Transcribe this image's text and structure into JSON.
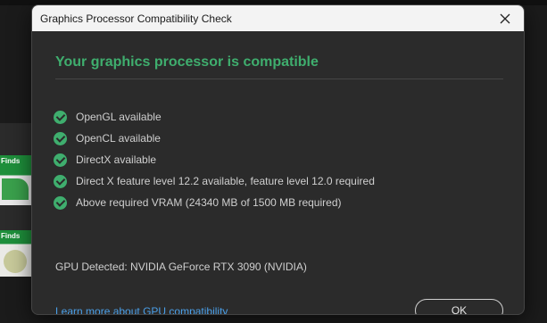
{
  "background": {
    "thumbnails": [
      {
        "label": "Finds"
      },
      {
        "label": "Finds"
      }
    ]
  },
  "dialog": {
    "title": "Graphics Processor Compatibility Check",
    "close_icon": "close-icon",
    "heading": "Your graphics processor is compatible",
    "checks": [
      {
        "icon": "check-circle-icon",
        "text": "OpenGL available"
      },
      {
        "icon": "check-circle-icon",
        "text": "OpenCL available"
      },
      {
        "icon": "check-circle-icon",
        "text": "DirectX available"
      },
      {
        "icon": "check-circle-icon",
        "text": "Direct X feature level 12.2 available, feature level 12.0 required"
      },
      {
        "icon": "check-circle-icon",
        "text": "Above required VRAM (24340 MB of 1500 MB required)"
      }
    ],
    "gpu_detected": "GPU Detected: NVIDIA GeForce RTX 3090 (NVIDIA)",
    "learn_more_link": "Learn more about GPU compatibility",
    "ok_label": "OK"
  },
  "colors": {
    "accent_green": "#3fae6e",
    "link_blue": "#4a9fe8",
    "dialog_bg": "#2b2b2b",
    "titlebar_bg": "#f3f3f3"
  }
}
